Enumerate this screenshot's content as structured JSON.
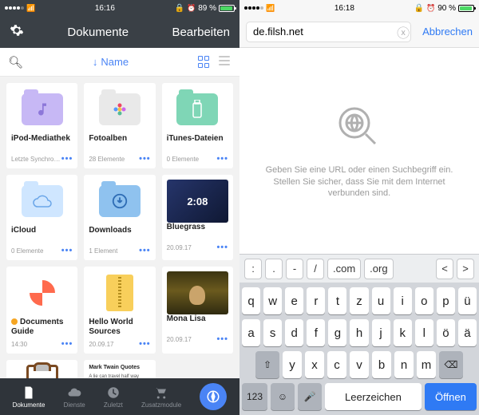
{
  "left": {
    "status": {
      "time": "16:16",
      "alarm": true,
      "battery": "89 %"
    },
    "nav": {
      "title": "Dokumente",
      "edit": "Bearbeiten"
    },
    "sort": {
      "label": "Name"
    },
    "items": [
      {
        "name": "iPod-Mediathek",
        "sub": "Letzte Synchro…",
        "kind": "folder",
        "color": "#c7b8f5",
        "icon": "music"
      },
      {
        "name": "Fotoalben",
        "sub": "28 Elemente",
        "kind": "folder",
        "color": "#e9e9e9",
        "icon": "flower"
      },
      {
        "name": "iTunes-Dateien",
        "sub": "0 Elemente",
        "kind": "folder",
        "color": "#7fd6b6",
        "icon": "usb"
      },
      {
        "name": "iCloud",
        "sub": "0 Elemente",
        "kind": "folder",
        "color": "#cfe6ff",
        "icon": "cloud"
      },
      {
        "name": "Downloads",
        "sub": "1 Element",
        "kind": "folder",
        "color": "#8fc2ef",
        "icon": "download"
      },
      {
        "name": "Bluegrass",
        "sub": "20.09.17",
        "kind": "video",
        "overlay": "2:08"
      },
      {
        "name": "Documents Guide",
        "sub": "14:30",
        "kind": "lifebuoy",
        "dot": true
      },
      {
        "name": "Hello World Sources",
        "sub": "20.09.17",
        "kind": "zip"
      },
      {
        "name": "Mona Lisa",
        "sub": "20.09.17",
        "kind": "mona"
      },
      {
        "name": "",
        "sub": "",
        "kind": "clipboard"
      },
      {
        "name": "",
        "sub": "",
        "kind": "quote",
        "qtitle": "Mark Twain Quotes",
        "qtext": "A lie can travel half way around the world while the truth is putting on its shoes."
      }
    ],
    "tabs": [
      {
        "label": "Dokumente",
        "icon": "doc"
      },
      {
        "label": "Dienste",
        "icon": "cloud"
      },
      {
        "label": "Zuletzt",
        "icon": "clock"
      },
      {
        "label": "Zusatzmodule",
        "icon": "cart"
      }
    ]
  },
  "right": {
    "status": {
      "time": "16:18",
      "alarm": true,
      "battery": "90 %"
    },
    "address": {
      "value": "de.filsh.net",
      "cancel": "Abbrechen"
    },
    "empty": {
      "text": "Geben Sie eine URL oder einen Suchbegriff ein. Stellen Sie sicher, dass Sie mit dem Internet verbunden sind."
    },
    "accessory": [
      ":",
      ".",
      "-",
      "/",
      ".com",
      ".org"
    ],
    "rows": [
      [
        "q",
        "w",
        "e",
        "r",
        "t",
        "z",
        "u",
        "i",
        "o",
        "p",
        "ü"
      ],
      [
        "a",
        "s",
        "d",
        "f",
        "g",
        "h",
        "j",
        "k",
        "l",
        "ö",
        "ä"
      ]
    ],
    "row3": [
      "y",
      "x",
      "c",
      "v",
      "b",
      "n",
      "m"
    ],
    "bottom": {
      "num": "123",
      "space": "Leerzeichen",
      "enter": "Öffnen"
    }
  }
}
